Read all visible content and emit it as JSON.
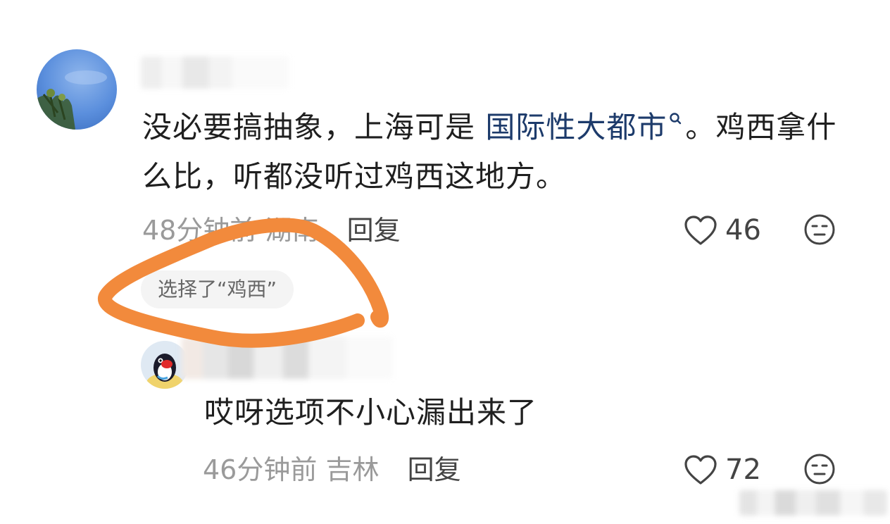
{
  "comment": {
    "text_part1": "没必要搞抽象，上海可是 ",
    "topic_link": "国际性大都市",
    "text_part2": "。鸡西拿什么比，听都没听过鸡西这地方。",
    "time": "48分钟前",
    "location": "湖南",
    "reply_label": "回复",
    "likes": "46",
    "choice_badge": "选择了“鸡西”"
  },
  "reply": {
    "text": "哎呀选项不小心漏出来了",
    "time": "46分钟前",
    "location": "吉林",
    "reply_label": "回复",
    "likes": "72"
  },
  "colors": {
    "annotation": "#f28a3c",
    "link": "#1d3b6b",
    "meta": "#9a9a9a"
  },
  "icons": [
    "heart-outline-icon",
    "emoji-icon",
    "search-icon"
  ]
}
